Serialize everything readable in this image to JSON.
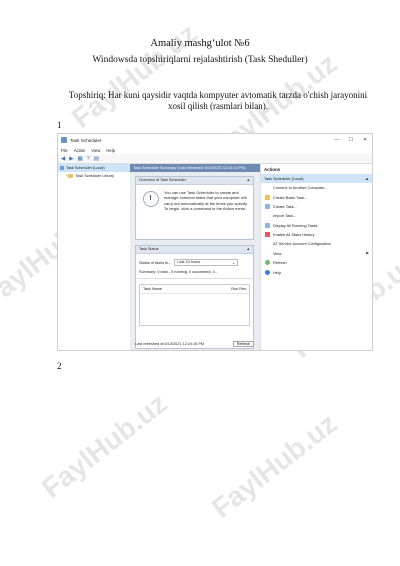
{
  "document": {
    "title": "Amaliy mashg‘ulot №6",
    "subtitle": "Windowsda topshiriqlarni rejalashtirish (Task Sheduller)",
    "task": "Topshiriq: Har kuni qaysidir vaqtda kompyuter avtomatik tarzda o'chish jarayonini xosil qilish (rasmlari bilan).",
    "step1": "1",
    "step2": "2"
  },
  "watermark": "FaylHub.uz",
  "window": {
    "title": "Task Scheduler",
    "controls": {
      "minimize": "—",
      "maximize": "☐",
      "close": "✕"
    },
    "menu": [
      "File",
      "Action",
      "View",
      "Help"
    ],
    "toolbar_icons": [
      "back-arrow-icon",
      "forward-arrow-icon",
      "console-tree-icon",
      "help-icon",
      "properties-icon"
    ],
    "tree": {
      "root": "Task Scheduler (Local)",
      "child": "Task Scheduler Library"
    },
    "center": {
      "header": "Task Scheduler Summary (Last refreshed: 5/13/2021 12:24:16 PM)",
      "overview": {
        "title": "Overview of Task Scheduler",
        "text": "You can use Task Scheduler to create and manage common tasks that your computer will carry out automatically at the times you specify. To begin, click a command in the Action menu."
      },
      "status": {
        "title": "Task Status",
        "label": "Status of tasks th...",
        "select_value": "Last 24 hours",
        "summary": "Summary: 0 total - 0 running, 0 succeeded, 0...",
        "col_task": "Task Name",
        "col_run": "Run Res"
      },
      "footer": {
        "last_refreshed": "Last refreshed at 5/13/2021 12:24:16 PM",
        "refresh": "Refresh"
      }
    },
    "actions": {
      "title": "Actions",
      "section": "Task Scheduler (Local)",
      "items": [
        "Connect to Another Computer...",
        "Create Basic Task...",
        "Create Task...",
        "Import Task...",
        "Display All Running Tasks",
        "Enable All Tasks History",
        "AT Service Account Configuration",
        "View",
        "Refresh",
        "Help"
      ]
    }
  }
}
